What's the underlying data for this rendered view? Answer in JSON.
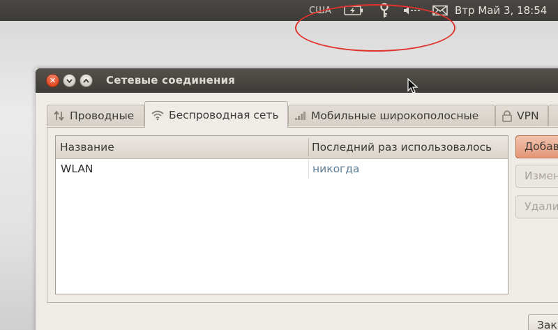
{
  "panel": {
    "keyboard_layout": "США",
    "clock": "Втр Май  3, 18:54",
    "indicators": [
      "battery-icon",
      "keyring-icon",
      "volume-icon",
      "mail-icon"
    ]
  },
  "window": {
    "title": "Сетевые соединения"
  },
  "tabs": [
    {
      "label": "Проводные",
      "icon": "wired-icon"
    },
    {
      "label": "Беспроводная сеть",
      "icon": "wireless-icon",
      "active": true
    },
    {
      "label": "Мобильные широкополосные",
      "icon": "mobile-signal-icon"
    },
    {
      "label": "VPN",
      "icon": "lock-icon"
    }
  ],
  "list": {
    "columns": [
      "Название",
      "Последний раз использовалось"
    ],
    "rows": [
      {
        "name": "WLAN",
        "last_used": "никогда"
      }
    ]
  },
  "buttons": {
    "add": "Добавить",
    "edit": "Изменить",
    "delete": "Удалить",
    "close": "Закрыть"
  },
  "colors": {
    "annotation": "#e0322c",
    "panel_bg": "#3c3b37",
    "accent_button": "#e49677"
  }
}
